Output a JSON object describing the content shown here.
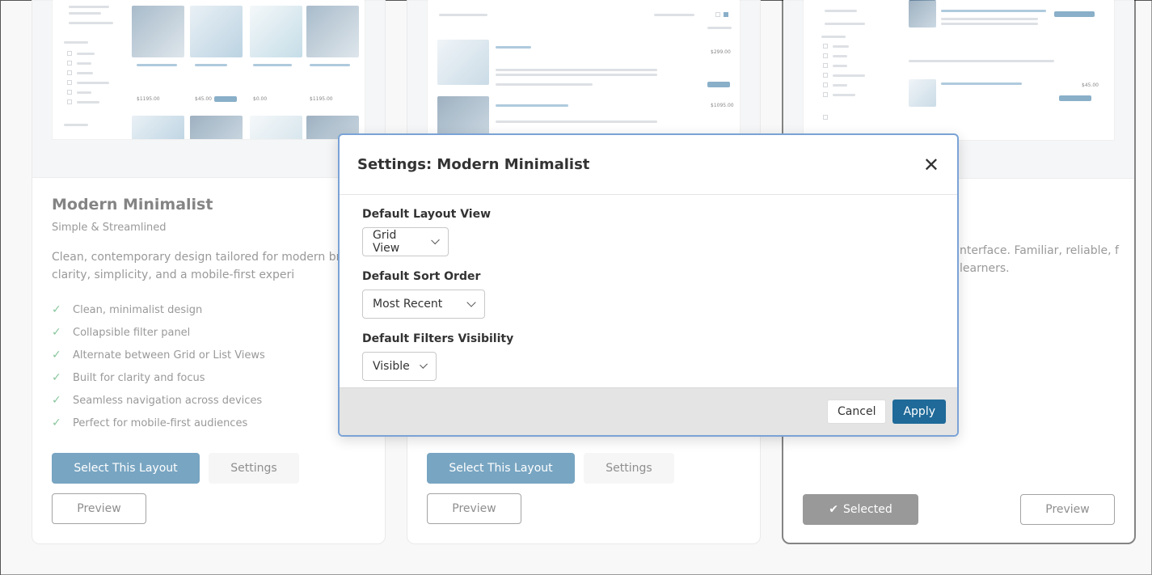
{
  "cards": [
    {
      "title": "Modern Minimalist",
      "subtitle": "Simple & Streamlined",
      "description": "Clean, contemporary design tailored for modern brand Focused on clarity, simplicity, and a mobile-first experi",
      "features": [
        "Clean, minimalist design",
        "Collapsible filter panel",
        "Alternate between Grid or List Views",
        "Built for clarity and focus",
        "Seamless navigation across devices",
        "Perfect for mobile-first audiences"
      ],
      "select_label": "Select This Layout",
      "settings_label": "Settings",
      "preview_label": "Preview",
      "mini_prices": [
        "$1195.00",
        "$45.00",
        "$0.00",
        "$1195.00"
      ]
    },
    {
      "select_label": "Select This Layout",
      "settings_label": "Settings",
      "preview_label": "Preview",
      "mini_prices": [
        "$299.00",
        "$1095.00"
      ]
    },
    {
      "description_partial": "nterface. Familiar, reliable, f learners.",
      "selected_label": "Selected",
      "preview_label": "Preview",
      "mini_prices": [
        "$45.00"
      ]
    }
  ],
  "modal": {
    "title": "Settings: Modern Minimalist",
    "fields": [
      {
        "label": "Default Layout View",
        "value": "Grid View"
      },
      {
        "label": "Default Sort Order",
        "value": "Most Recent"
      },
      {
        "label": "Default Filters Visibility",
        "value": "Visible"
      }
    ],
    "cancel_label": "Cancel",
    "apply_label": "Apply"
  },
  "icons": {
    "check": "check-icon",
    "close": "close-icon",
    "chevron": "chevron-down-icon"
  },
  "colors": {
    "primary": "#1f6a99",
    "check": "#3aa15a",
    "modal_border": "#7aa3d6"
  }
}
